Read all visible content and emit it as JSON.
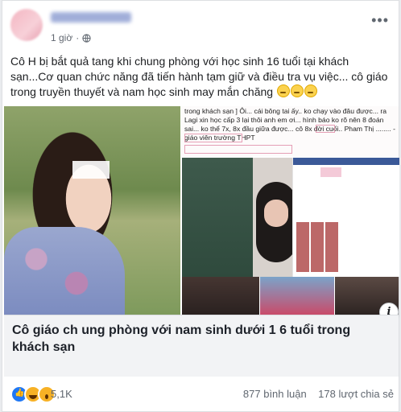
{
  "post": {
    "author_name": "Hương Lệ ...",
    "time": "1 giờ",
    "privacy_icon": "globe-icon",
    "menu_icon": "more-icon",
    "text": "Cô H bị bắt quả tang khi chung phòng với học sinh 16 tuổi tại khách sạn...Cơ quan chức năng đã tiến hành tạm giữ và điều tra vụ việc... cô giáo trong truyền thuyết và nam học sinh may mắn chăng"
  },
  "media": {
    "screenshot_text": "trong khách sạn ] Ôi... cái bông tai ấy.. ko chạy vào đâu được... ra Lagi xin học cấp 3 lại thôi anh em ơi... hình báo ko rõ nên 8 đoán sai... ko thể 7x, 8x đầu giữa được... cô 8x đời cuối.. Pham Thị ........ - giáo viên trường THPT",
    "info_icon": "info-icon",
    "info_label": "i"
  },
  "link": {
    "title": "Cô giáo ch ung phòng với nam sinh dưới 1 6 tuổi trong khách sạn"
  },
  "footer": {
    "reaction_icons": [
      "like-icon",
      "haha-icon",
      "wow-icon"
    ],
    "reaction_count": "5,1K",
    "comments": "877 bình luận",
    "shares": "178 lượt chia sẻ"
  },
  "colors": {
    "facebook_blue": "#3b5998",
    "like_blue": "#2078f4",
    "reaction_yellow": "#f7b125",
    "text": "#1c1e21",
    "muted": "#606770",
    "link_bg": "#f2f3f5"
  }
}
